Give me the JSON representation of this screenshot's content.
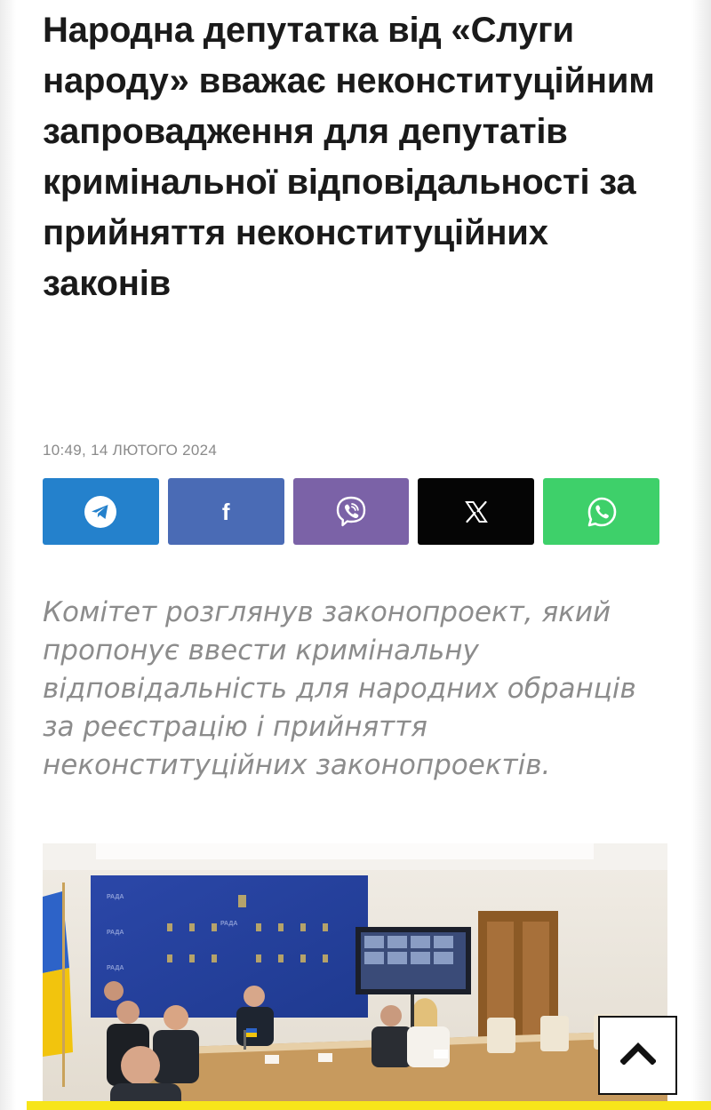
{
  "article": {
    "title": "Народна депутатка від «Слуги народу» вважає неконституційним запровадження для депутатів кримінальної відповідальності за прийняття неконституційних законів",
    "date": "10:49, 14 ЛЮТОГО 2024",
    "lead": "Комітет розглянув законопроект, який пропонує ввести кримінальну відповідальність для народних обранців за реєстрацію і прийняття неконституційних законопроектів.",
    "photo_caption_labels": {
      "backdrop_word": "РАДА"
    }
  },
  "share": {
    "buttons": [
      {
        "network": "telegram",
        "icon": "telegram-icon",
        "color": "#2481cc"
      },
      {
        "network": "facebook",
        "icon": "facebook-icon",
        "color": "#4a6bb5",
        "glyph": "f"
      },
      {
        "network": "viber",
        "icon": "viber-icon",
        "color": "#7b62a7"
      },
      {
        "network": "x",
        "icon": "x-icon",
        "color": "#050505"
      },
      {
        "network": "whatsapp",
        "icon": "whatsapp-icon",
        "color": "#3ed06a"
      }
    ]
  },
  "scroll_top": {
    "icon": "chevron-up-icon"
  },
  "colors": {
    "accent_bar": "#f7e51a",
    "title": "#1a1a1a",
    "lead": "#8c8c8c",
    "date": "#8a8a8a"
  }
}
